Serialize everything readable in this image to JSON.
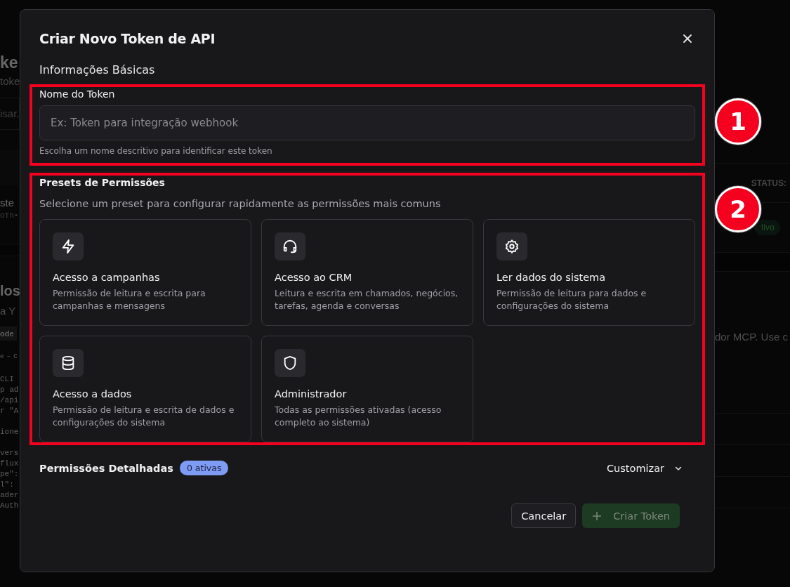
{
  "background": {
    "left": {
      "title": "ke",
      "subtitle": "toke",
      "search": "isar.",
      "row_name": "ste",
      "row_token": "oTn•",
      "section_title": "los",
      "section_text": "a Y",
      "code_tab": "ode",
      "code_caption": "e – C",
      "code_lines": [
        "CLI",
        "p ad",
        "/api",
        "r \"A",
        "ione",
        "vers",
        "flux",
        "pe\":",
        "l\":",
        "ader",
        "Auth"
      ]
    },
    "right": {
      "column_header": "STATUS:",
      "status_badge": "tivo",
      "section_text": "dor MCP. Use c"
    }
  },
  "dialog": {
    "title": "Criar Novo Token de API",
    "section_title": "Informações Básicas",
    "name_field": {
      "callout": "1",
      "label": "Nome do Token",
      "placeholder": "Ex: Token para integração webhook",
      "hint": "Escolha um nome descritivo para identificar este token"
    },
    "presets": {
      "callout": "2",
      "title": "Presets de Permissões",
      "description": "Selecione um preset para configurar rapidamente as permissões mais comuns",
      "items": [
        {
          "title": "Acesso a campanhas",
          "description": "Permissão de leitura e escrita para campanhas e mensagens"
        },
        {
          "title": "Acesso ao CRM",
          "description": "Leitura e escrita em chamados, negócios, tarefas, agenda e conversas"
        },
        {
          "title": "Ler dados do sistema",
          "description": "Permissão de leitura para dados e configurações do sistema"
        },
        {
          "title": "Acesso a dados",
          "description": "Permissão de leitura e escrita de dados e configurações do sistema"
        },
        {
          "title": "Administrador",
          "description": "Todas as permissões ativadas (acesso completo ao sistema)"
        }
      ]
    },
    "detailed": {
      "title": "Permissões Detalhadas",
      "badge": "0 ativas",
      "toggle": "Customizar",
      "expanded": false
    },
    "buttons": {
      "cancel": "Cancelar",
      "submit": "Criar Token",
      "submit_disabled": true
    }
  }
}
